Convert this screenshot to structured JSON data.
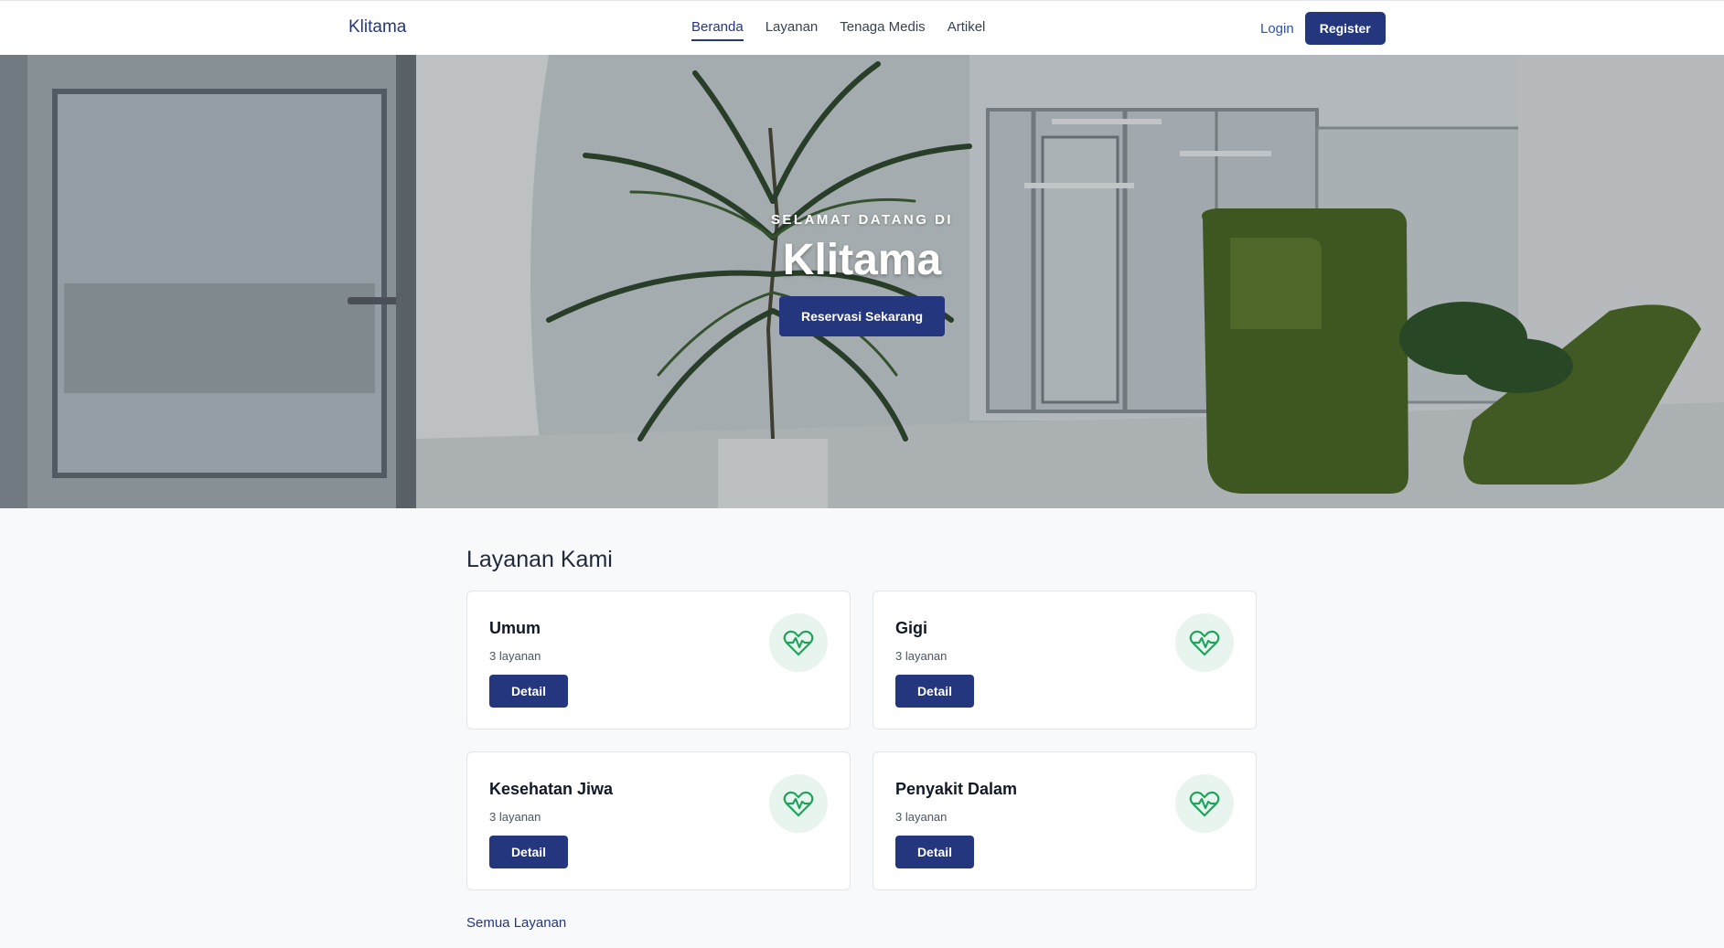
{
  "navbar": {
    "brand": "Klitama",
    "links": [
      {
        "label": "Beranda",
        "active": true
      },
      {
        "label": "Layanan",
        "active": false
      },
      {
        "label": "Tenaga Medis",
        "active": false
      },
      {
        "label": "Artikel",
        "active": false
      }
    ],
    "login_label": "Login",
    "register_label": "Register"
  },
  "hero": {
    "eyebrow": "SELAMAT DATANG DI",
    "title": "Klitama",
    "cta_label": "Reservasi Sekarang"
  },
  "services": {
    "title": "Layanan Kami",
    "items": [
      {
        "name": "Umum",
        "count": "3 layanan",
        "button": "Detail",
        "icon": "heart-pulse-icon"
      },
      {
        "name": "Gigi",
        "count": "3 layanan",
        "button": "Detail",
        "icon": "heart-pulse-icon"
      },
      {
        "name": "Kesehatan Jiwa",
        "count": "3 layanan",
        "button": "Detail",
        "icon": "heart-pulse-icon"
      },
      {
        "name": "Penyakit Dalam",
        "count": "3 layanan",
        "button": "Detail",
        "icon": "heart-pulse-icon"
      }
    ],
    "all_link": "Semua Layanan"
  },
  "colors": {
    "primary": "#23367e",
    "link": "#2b50b5",
    "icon_bg": "#e8f5ee",
    "icon_stroke": "#1fa35c",
    "page_bg": "#f8f9fb"
  }
}
